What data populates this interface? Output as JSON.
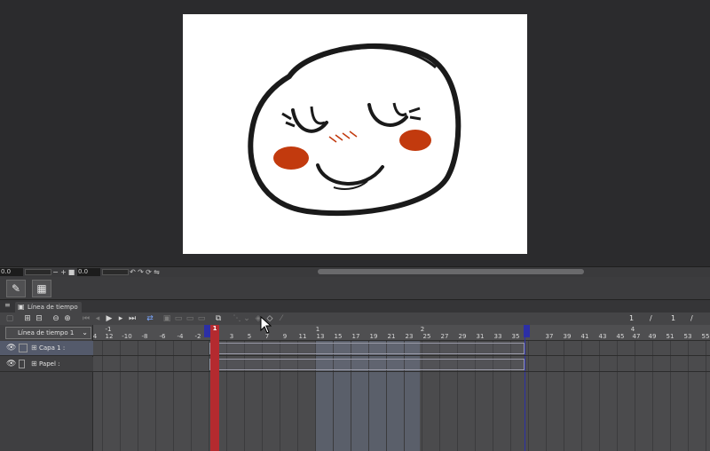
{
  "status_bar": {
    "zoom_value": "0.0",
    "rotate_value": "0.0",
    "minus": "−",
    "plus": "+"
  },
  "panel": {
    "tab_title": "Línea de tiempo"
  },
  "timeline": {
    "selected_timeline": "Línea de tiempo 1",
    "frame_counter": {
      "current": "1",
      "sep": "/",
      "total": "1"
    },
    "tracks": [
      {
        "name": "Capa 1 :",
        "active": true
      },
      {
        "name": "Papel :",
        "active": false
      }
    ],
    "current_frame_label": "1",
    "frame_ticks": [
      "4",
      "12",
      "-10",
      "-8",
      "-6",
      "-4",
      "-2",
      "3",
      "5",
      "7",
      "9",
      "11",
      "13",
      "15",
      "17",
      "19",
      "21",
      "23",
      "25",
      "27",
      "29",
      "31",
      "33",
      "35",
      "37",
      "39",
      "41",
      "43",
      "45",
      "47",
      "49",
      "51",
      "53",
      "55",
      "57"
    ],
    "second_markers": [
      "-1",
      "1",
      "2",
      "4"
    ]
  },
  "icons": {
    "eye": "eye-icon",
    "layer": "layer-icon",
    "paper": "paper-icon",
    "brush": "brush-icon",
    "film": "film-icon"
  }
}
